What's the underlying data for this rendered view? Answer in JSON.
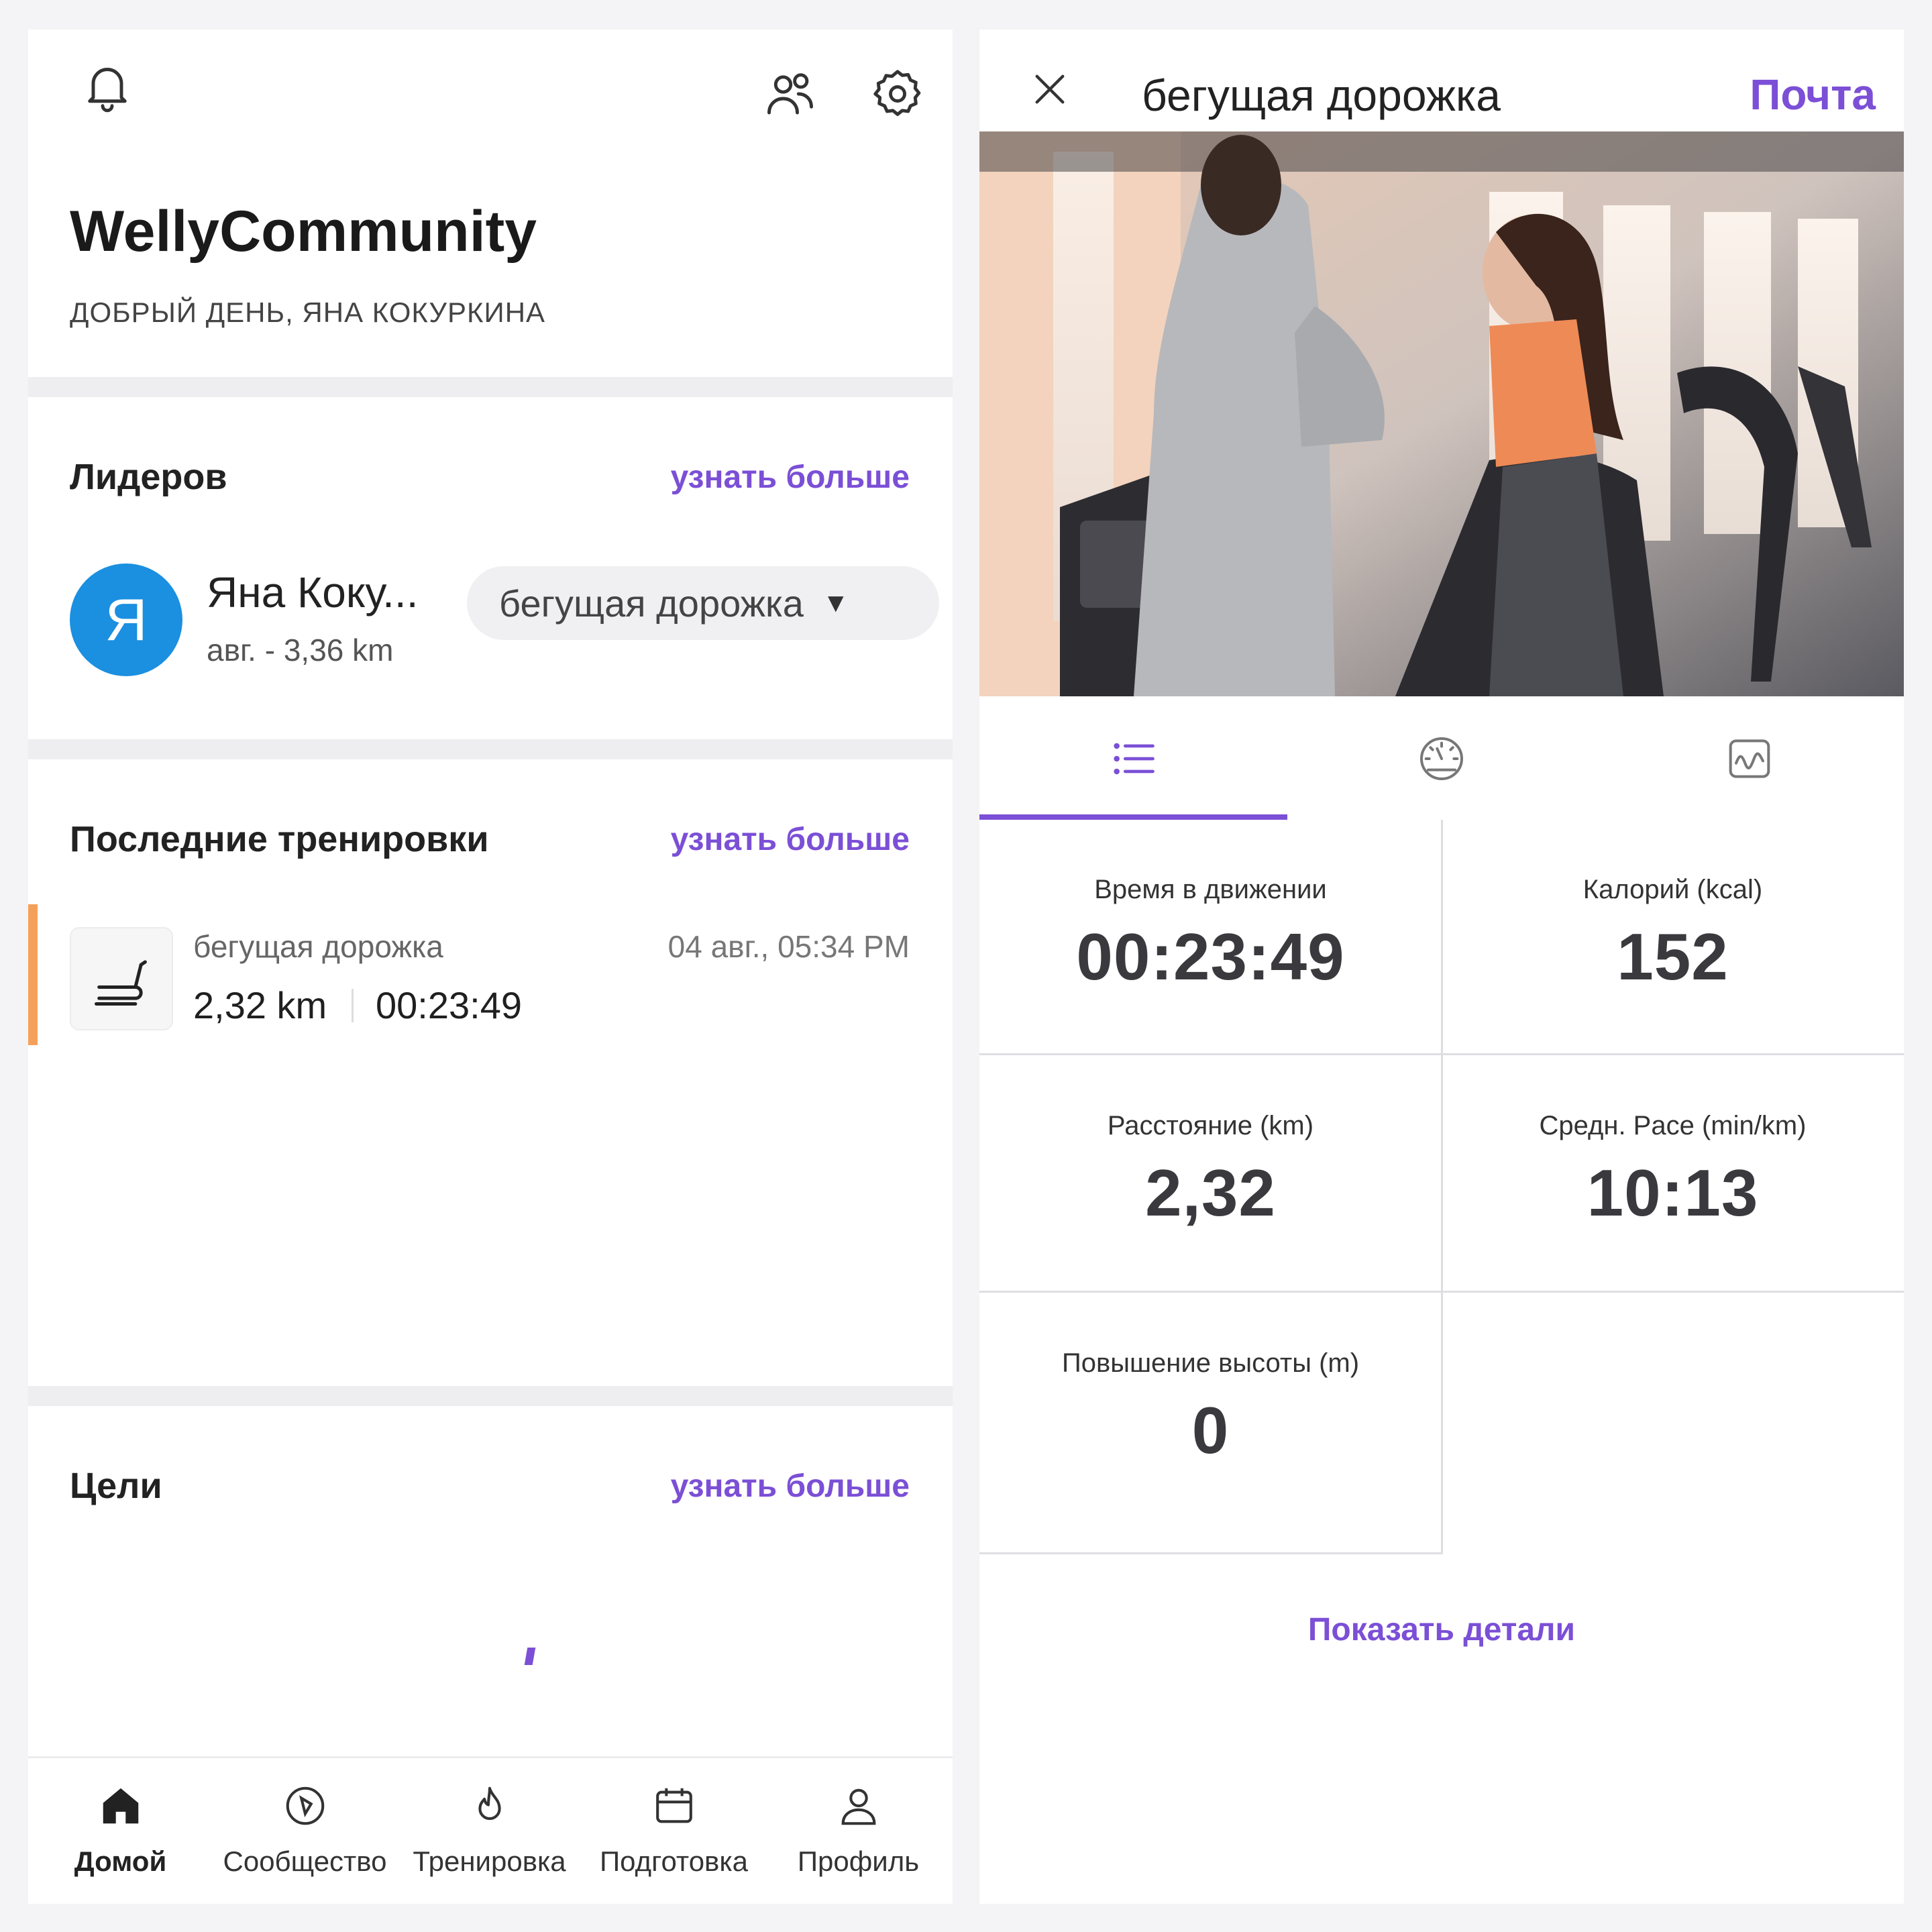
{
  "left": {
    "brand_title": "WellyCommunity",
    "greeting": "ДОБРЫЙ ДЕНЬ, ЯНА КОКУРКИНА",
    "leaders": {
      "title": "Лидеров",
      "more_link": "узнать больше",
      "user_initial": "Я",
      "user_name": "Яна Коку...",
      "user_sub": "авг. - 3,36 km",
      "activity_select": "бегущая дорожка"
    },
    "recent": {
      "title": "Последние тренировки",
      "more_link": "узнать больше",
      "item": {
        "name": "бегущая дорожка",
        "datetime": "04 авг., 05:34 PM",
        "distance": "2,32 km",
        "duration": "00:23:49"
      }
    },
    "goals": {
      "title": "Цели",
      "more_link": "узнать больше"
    },
    "nav": [
      {
        "label": "Домой",
        "icon": "home-icon",
        "active": true
      },
      {
        "label": "Сообщество",
        "icon": "compass-icon",
        "active": false
      },
      {
        "label": "Тренировка",
        "icon": "flame-icon",
        "active": false
      },
      {
        "label": "Подготовка",
        "icon": "calendar-icon",
        "active": false
      },
      {
        "label": "Профиль",
        "icon": "user-icon",
        "active": false
      }
    ]
  },
  "right": {
    "title": "бегущая дорожка",
    "mail_action": "Почта",
    "tabs": [
      {
        "icon": "list-icon",
        "active": true
      },
      {
        "icon": "gauge-icon",
        "active": false
      },
      {
        "icon": "chart-wave-icon",
        "active": false
      }
    ],
    "stats": [
      {
        "label": "Время в движении",
        "value": "00:23:49"
      },
      {
        "label": "Калорий (kcal)",
        "value": "152"
      },
      {
        "label": "Расстояние (km)",
        "value": "2,32"
      },
      {
        "label": "Средн. Pace (min/km)",
        "value": "10:13"
      },
      {
        "label": "Повышение высоты (m)",
        "value": "0"
      }
    ],
    "details_link": "Показать детали"
  },
  "colors": {
    "accent": "#7b4fd6",
    "avatar": "#1b8fe0",
    "workout_accent": "#f5a05a"
  }
}
